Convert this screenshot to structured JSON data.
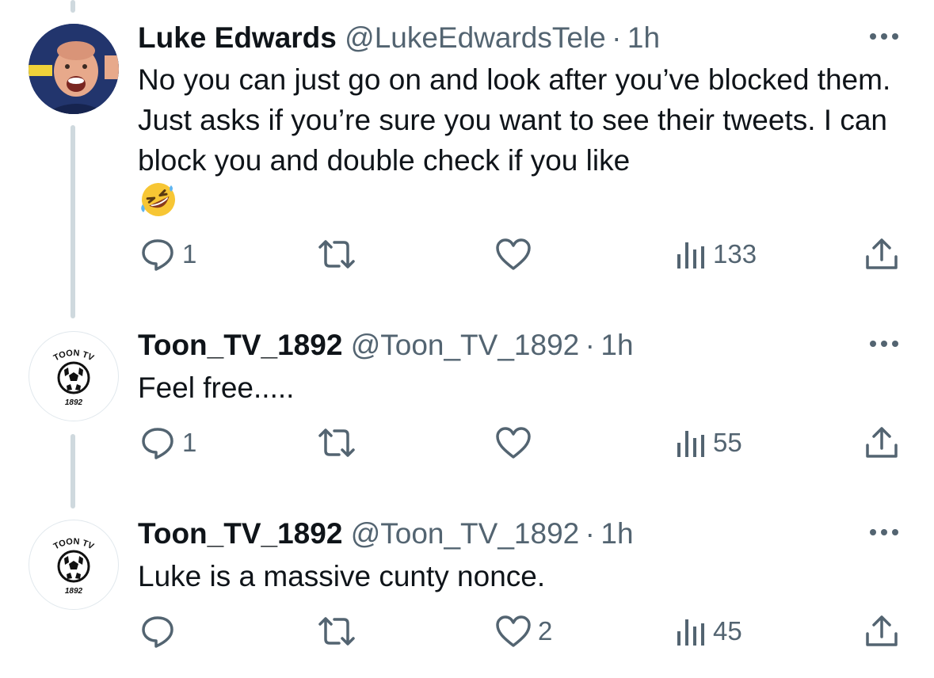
{
  "tweets": [
    {
      "name": "Luke Edwards",
      "handle": "@LukeEdwardsTele",
      "separator": "·",
      "time": "1h",
      "text": "No you can just go on and look after you’ve blocked them. Just asks if you’re sure you want to see their tweets. I can block you and double check if you like",
      "emoji": "🤣",
      "avatar": "profile-photo",
      "reply_count": "1",
      "retweet_count": "",
      "like_count": "",
      "view_count": "133"
    },
    {
      "name": "Toon_TV_1892",
      "handle": "@Toon_TV_1892",
      "separator": "·",
      "time": "1h",
      "text": "Feel free.....",
      "avatar": "toon-tv-logo",
      "avatar_text_top": "TOON TV",
      "avatar_text_bottom": "1892",
      "reply_count": "1",
      "retweet_count": "",
      "like_count": "",
      "view_count": "55"
    },
    {
      "name": "Toon_TV_1892",
      "handle": "@Toon_TV_1892",
      "separator": "·",
      "time": "1h",
      "text": "Luke is a massive cunty nonce.",
      "avatar": "toon-tv-logo",
      "avatar_text_top": "TOON TV",
      "avatar_text_bottom": "1892",
      "reply_count": "",
      "retweet_count": "",
      "like_count": "2",
      "view_count": "45"
    }
  ],
  "icons": {
    "reply": "reply-icon",
    "retweet": "retweet-icon",
    "like": "heart-icon",
    "views": "views-icon",
    "share": "share-icon",
    "more": "more-icon"
  },
  "colors": {
    "text": "#0f1419",
    "secondary": "#536471",
    "thread_line": "#cfd9de"
  }
}
